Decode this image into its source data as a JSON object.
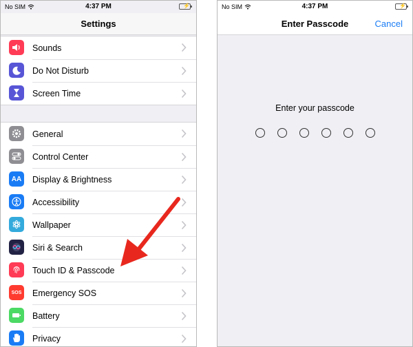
{
  "left": {
    "status": {
      "carrier": "No SIM",
      "time": "4:37 PM"
    },
    "title": "Settings",
    "groups": [
      [
        {
          "label": "Sounds",
          "icon": "speaker-icon",
          "color": "#ff3b55"
        },
        {
          "label": "Do Not Disturb",
          "icon": "moon-icon",
          "color": "#5856d6"
        },
        {
          "label": "Screen Time",
          "icon": "hourglass-icon",
          "color": "#5856d6"
        }
      ],
      [
        {
          "label": "General",
          "icon": "gear-icon",
          "color": "#8e8e93"
        },
        {
          "label": "Control Center",
          "icon": "toggles-icon",
          "color": "#8e8e93"
        },
        {
          "label": "Display & Brightness",
          "icon": "text-size-icon",
          "color": "#1a7cf5",
          "glyph": "AA"
        },
        {
          "label": "Accessibility",
          "icon": "accessibility-icon",
          "color": "#1a7cf5"
        },
        {
          "label": "Wallpaper",
          "icon": "flower-icon",
          "color": "#34aadc"
        },
        {
          "label": "Siri & Search",
          "icon": "siri-icon",
          "color": "#222244"
        },
        {
          "label": "Touch ID & Passcode",
          "icon": "fingerprint-icon",
          "color": "#ff3b55"
        },
        {
          "label": "Emergency SOS",
          "icon": "sos-icon",
          "color": "#ff3b30",
          "glyph": "SOS"
        },
        {
          "label": "Battery",
          "icon": "battery-icon",
          "color": "#4cd964"
        },
        {
          "label": "Privacy",
          "icon": "hand-icon",
          "color": "#1a7cf5"
        }
      ]
    ]
  },
  "right": {
    "status": {
      "carrier": "No SIM",
      "time": "4:37 PM"
    },
    "title": "Enter Passcode",
    "cancel": "Cancel",
    "prompt": "Enter your passcode",
    "digit_count": 6
  },
  "colors": {
    "accent": "#1a7cf5",
    "arrow": "#e8281e"
  }
}
